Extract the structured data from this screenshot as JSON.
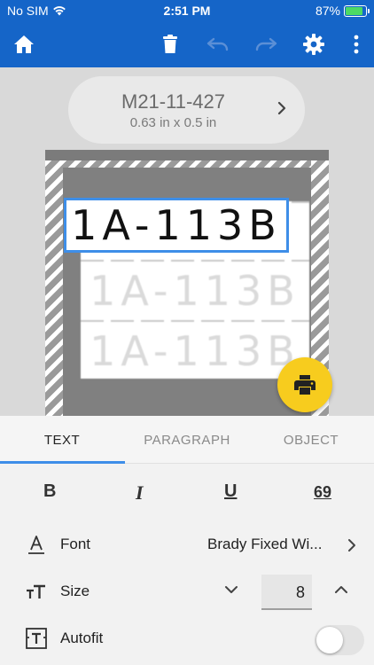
{
  "status_bar": {
    "carrier": "No SIM",
    "time": "2:51 PM",
    "battery": "87%",
    "battery_level": 0.87
  },
  "toolbar": {
    "icons": [
      "home-icon",
      "trash-icon",
      "undo-icon",
      "redo-icon",
      "gear-icon",
      "more-vert-icon"
    ]
  },
  "label": {
    "name": "M21-11-427",
    "dimensions": "0.63 in x 0.5 in"
  },
  "canvas": {
    "text": "1A-113B"
  },
  "tabs": [
    {
      "label": "TEXT",
      "active": true
    },
    {
      "label": "PARAGRAPH",
      "active": false
    },
    {
      "label": "OBJECT",
      "active": false
    }
  ],
  "format": {
    "bold": "B",
    "italic": "I",
    "underline": "U",
    "rotate": "69"
  },
  "font": {
    "label": "Font",
    "value": "Brady Fixed Wi..."
  },
  "size": {
    "label": "Size",
    "value": "8"
  },
  "autofit": {
    "label": "Autofit",
    "enabled": false
  },
  "colors": {
    "brand": "#1565c8",
    "accent": "#3e8ee8",
    "print_button": "#f7cc1e"
  }
}
